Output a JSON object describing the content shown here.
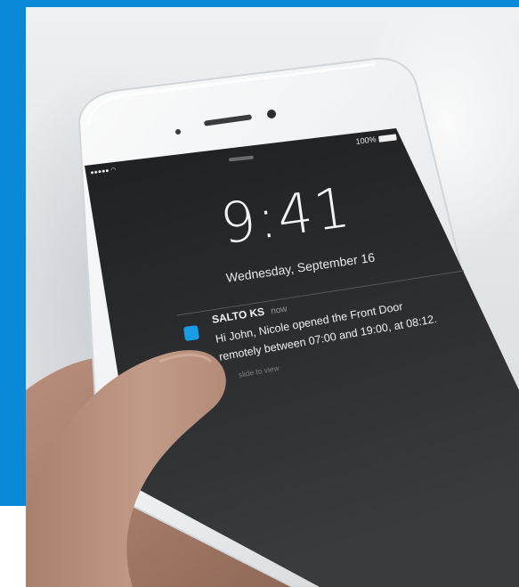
{
  "status_bar": {
    "battery": "100%"
  },
  "lock_screen": {
    "time": "9:41",
    "date": "Wednesday, September 16"
  },
  "notification": {
    "app_name": "SALTO KS",
    "timestamp": "now",
    "message_line1": "Hi John, Nicole opened the Front Door",
    "message_line2": "remotely between 07:00 and 19:00, at 08:12.",
    "action_hint": "slide to view"
  },
  "colors": {
    "brand_blue": "#0a8ad6",
    "app_icon": "#1a9be6",
    "screen": "#2a2b2d"
  }
}
